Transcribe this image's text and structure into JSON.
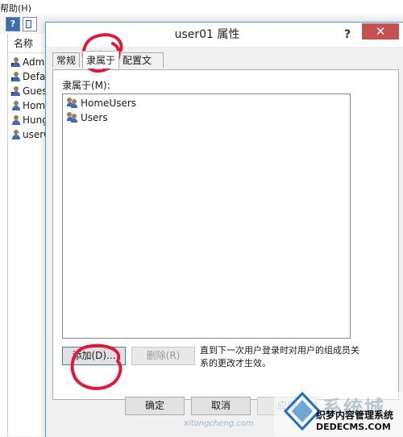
{
  "background": {
    "menu_help": "帮助(H)",
    "list_header": "名称",
    "users": [
      "Admi",
      "Defa",
      "Gues",
      "Home",
      "Hung",
      "userC"
    ]
  },
  "dialog": {
    "title": "user01 属性",
    "help_glyph": "?",
    "close_glyph": "✕",
    "tabs": [
      {
        "label": "常规",
        "active": false
      },
      {
        "label": "隶属于",
        "active": true
      },
      {
        "label": "配置文件",
        "active": false
      }
    ],
    "member_label": "隶属于(M):",
    "groups": [
      "HomeUsers",
      "Users"
    ],
    "add_button": "添加(D)...",
    "remove_button": "删除(R)",
    "note": "直到下一次用户登录时对用户的组成员关系的更改才生效。",
    "ok_button": "确定",
    "cancel_button": "取消",
    "apply_button": "应用"
  },
  "annotation_color": "#e0193a",
  "watermark": {
    "brand": "系统城",
    "site_small": "xitongcheng.com",
    "cn_text": "织梦内容管理系统",
    "url": "DEDECMS.COM"
  }
}
